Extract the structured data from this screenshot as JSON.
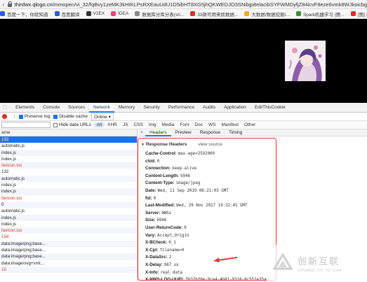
{
  "browser": {
    "url_host": "thirdwx.qlogo.cn",
    "url_path": "/mmopen/vi_32/fqBvy1zeMK3kHIKLPsRXEauUdU1D5ibHT8XG5jhQKWEDJO3SNibjp8elacibSYFWMDyfjZ84icvF8eze6vmk8WJkoicbg/132"
  },
  "bookmarks": [
    {
      "label": "百度一下，你就知道",
      "color": "#2b5cd8"
    },
    {
      "label": "百度翻译",
      "color": "#2b5cd8"
    },
    {
      "label": "V2EX",
      "color": "#333"
    },
    {
      "label": "IDEA",
      "color": "#e8447a"
    },
    {
      "label": "数据库分库分表(sh...",
      "color": "#888"
    },
    {
      "label": "33款可用来抓数据...",
      "color": "#d93025"
    },
    {
      "label": "大数据/数据挖掘/...",
      "color": "#f5a623"
    },
    {
      "label": "Spark机器学习 (图...",
      "color": "#3b8c3b"
    },
    {
      "label": "[图] 烈风*米格1",
      "color": "#d93025"
    }
  ],
  "devtools": {
    "tabs": [
      "Elements",
      "Console",
      "Sources",
      "Network",
      "Memory",
      "Security",
      "Performance",
      "Audits",
      "Application",
      "EditThisCookie"
    ],
    "active_tab": "Network",
    "filter_row": {
      "preserve_log": "Preserve log",
      "disable_cache": "Disable cache",
      "throttle": "Online"
    },
    "type_row": {
      "hide_data_urls": "Hide data URLs",
      "types": [
        "All",
        "XHR",
        "JS",
        "CSS",
        "Img",
        "Media",
        "Font",
        "Doc",
        "WS",
        "Manifest",
        "Other"
      ]
    },
    "list_header": "ame",
    "requests": [
      {
        "name": "132",
        "state": "selected"
      },
      {
        "name": "automatic.js",
        "state": ""
      },
      {
        "name": "index.js",
        "state": "alt"
      },
      {
        "name": "index.js",
        "state": ""
      },
      {
        "name": "favicon.ico",
        "state": "red alt"
      },
      {
        "name": "132",
        "state": ""
      },
      {
        "name": "automatic.js",
        "state": "alt"
      },
      {
        "name": "index.js",
        "state": ""
      },
      {
        "name": "index.js",
        "state": "alt"
      },
      {
        "name": "favicon.ico",
        "state": "red"
      },
      {
        "name": "0",
        "state": "alt"
      },
      {
        "name": "automatic.js",
        "state": ""
      },
      {
        "name": "index.js",
        "state": "alt"
      },
      {
        "name": "index.js",
        "state": ""
      },
      {
        "name": "favicon.ico",
        "state": "red alt"
      },
      {
        "name": "154",
        "state": "red"
      },
      {
        "name": "data:image/png;base...",
        "state": "alt"
      },
      {
        "name": "data:image/png;base...",
        "state": ""
      },
      {
        "name": "data:image/png;base...",
        "state": "alt"
      },
      {
        "name": "data:image/svg+xml;...",
        "state": ""
      },
      {
        "name": "15",
        "state": "red alt"
      }
    ],
    "panel": {
      "tabs": [
        "Headers",
        "Preview",
        "Response",
        "Timing"
      ],
      "active_tab": "Headers",
      "section_title": "Response Headers",
      "view_source": "view source",
      "headers": [
        {
          "k": "Cache-Control:",
          "v": "max-age=2592000"
        },
        {
          "k": "chid:",
          "v": "0"
        },
        {
          "k": "Connection:",
          "v": "keep-alive"
        },
        {
          "k": "Content-Length:",
          "v": "6946"
        },
        {
          "k": "Content-Type:",
          "v": "image/jpeg"
        },
        {
          "k": "Date:",
          "v": "Wed, 11 Sep 2019 06:21:03 GMT"
        },
        {
          "k": "fid:",
          "v": "0"
        },
        {
          "k": "Last-Modified:",
          "v": "Wed, 29 Nov 2017 19:32:45 GMT"
        },
        {
          "k": "Server:",
          "v": "NWSs"
        },
        {
          "k": "Size:",
          "v": "6946"
        },
        {
          "k": "User-ReturnCode:",
          "v": "0"
        },
        {
          "k": "Vary:",
          "v": "Accept,Origin"
        },
        {
          "k": "X-BCheck:",
          "v": "0_1"
        },
        {
          "k": "X-Cpt:",
          "v": "filename=0"
        },
        {
          "k": "X-DataSrc:",
          "v": "2"
        },
        {
          "k": "X-Delay:",
          "v": "987 us"
        },
        {
          "k": "X-Info:",
          "v": "real data"
        },
        {
          "k": "X-NWS-LOG-UUID:",
          "v": "f637bf0e-9ce4-4b81-9316-8c551e35a0"
        },
        {
          "k": "X-ReqGue:",
          "v": "0"
        }
      ]
    }
  },
  "watermark": {
    "cn": "创新互联",
    "en": "CHUANG XIN HU LIAN"
  },
  "colors": {
    "accent": "#1a73e8",
    "annotation_red": "#e53935"
  }
}
